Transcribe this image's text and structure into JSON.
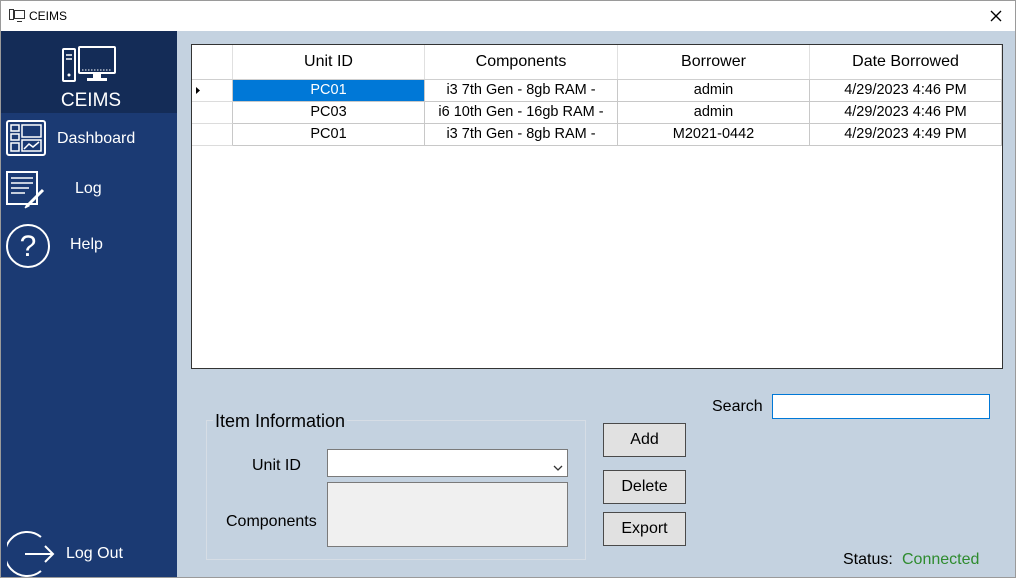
{
  "window": {
    "title": "CEIMS"
  },
  "sidebar": {
    "brand": "CEIMS",
    "items": [
      {
        "label": "Dashboard",
        "icon": "dashboard-icon"
      },
      {
        "label": "Log",
        "icon": "log-icon"
      },
      {
        "label": "Help",
        "icon": "help-icon"
      }
    ],
    "logout": {
      "label": "Log Out",
      "icon": "logout-icon"
    }
  },
  "grid": {
    "columns": [
      "Unit ID",
      "Components",
      "Borrower",
      "Date Borrowed"
    ],
    "rows": [
      {
        "unit_id": "PC01",
        "components": "i3 7th Gen - 8gb RAM -",
        "borrower": "admin",
        "date": "4/29/2023 4:46 PM",
        "selected": true
      },
      {
        "unit_id": "PC03",
        "components": "i6 10th Gen - 16gb RAM -",
        "borrower": "admin",
        "date": "4/29/2023 4:46 PM",
        "selected": false
      },
      {
        "unit_id": "PC01",
        "components": "i3 7th Gen - 8gb RAM -",
        "borrower": "M2021-0442",
        "date": "4/29/2023 4:49 PM",
        "selected": false
      }
    ]
  },
  "item_info": {
    "title": "Item Information",
    "unit_id_label": "Unit ID",
    "unit_id_value": "",
    "components_label": "Components",
    "components_value": ""
  },
  "buttons": {
    "add": "Add",
    "delete": "Delete",
    "export": "Export"
  },
  "search": {
    "label": "Search",
    "value": ""
  },
  "status": {
    "label": "Status:",
    "value": "Connected",
    "color": "#2e8b2e"
  },
  "colors": {
    "sidebar": "#1b3a73",
    "sidebar_header": "#142c57",
    "main_bg": "#c4d2e0",
    "selection": "#0078d7"
  }
}
